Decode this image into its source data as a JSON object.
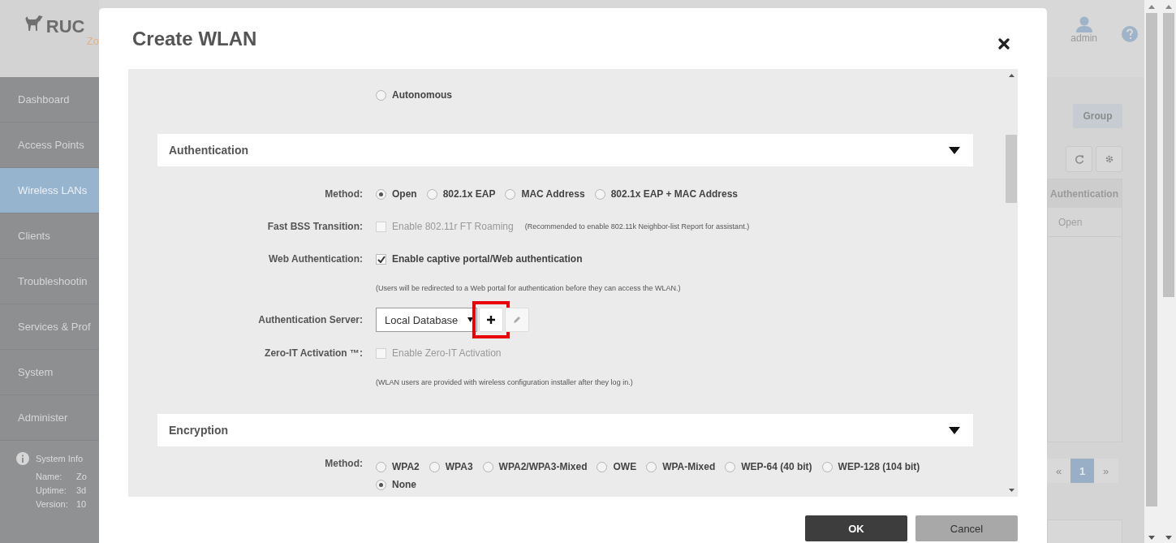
{
  "app": {
    "logo_text": "RUC",
    "logo_subtext": "Zo",
    "nav": [
      {
        "label": "Dashboard",
        "selected": false
      },
      {
        "label": "Access Points",
        "selected": false
      },
      {
        "label": "Wireless LANs",
        "selected": true
      },
      {
        "label": "Clients",
        "selected": false
      },
      {
        "label": "Troubleshootin",
        "selected": false
      },
      {
        "label": "Services & Prof",
        "selected": false
      },
      {
        "label": "System",
        "selected": false
      },
      {
        "label": "Administer",
        "selected": false
      }
    ],
    "system_info": {
      "title": "System Info",
      "rows": [
        {
          "label": "Name:",
          "value": "Zo"
        },
        {
          "label": "Uptime:",
          "value": "3d"
        },
        {
          "label": "Version:",
          "value": "10"
        }
      ]
    },
    "user": "admin",
    "view_tab": "Group",
    "table": {
      "columns": [
        "Authentication"
      ],
      "rows": [
        [
          "Open"
        ]
      ]
    },
    "pagination": [
      {
        "label": "«",
        "selected": false
      },
      {
        "label": "1",
        "selected": true
      },
      {
        "label": "»",
        "selected": false
      }
    ]
  },
  "dialog": {
    "title": "Create WLAN",
    "top_options": [
      {
        "label": "Autonomous",
        "selected": false
      }
    ],
    "sections": [
      {
        "title": "Authentication",
        "expanded": true,
        "rows": [
          {
            "kind": "radio",
            "label": "Method:",
            "options": [
              {
                "label": "Open",
                "selected": true
              },
              {
                "label": "802.1x EAP",
                "selected": false
              },
              {
                "label": "MAC Address",
                "selected": false
              },
              {
                "label": "802.1x EAP + MAC Address",
                "selected": false
              }
            ]
          },
          {
            "kind": "checkbox",
            "label": "Fast BSS Transition:",
            "text": "Enable 802.11r FT Roaming",
            "checked": false,
            "disabled": true,
            "note": "(Recommended to enable 802.11k Neighbor-list Report for assistant.)"
          },
          {
            "kind": "checkbox",
            "label": "Web Authentication:",
            "text": "Enable captive portal/Web authentication",
            "checked": true,
            "disabled": false
          },
          {
            "kind": "note",
            "text": "(Users will be redirected to a Web portal for authentication before they can access the WLAN.)"
          },
          {
            "kind": "select",
            "label": "Authentication Server:",
            "value": "Local Database",
            "add_highlighted": true
          },
          {
            "kind": "checkbox",
            "label": "Zero-IT Activation ™:",
            "text": "Enable Zero-IT Activation",
            "checked": false,
            "disabled": true
          },
          {
            "kind": "note",
            "text": "(WLAN users are provided with wireless configuration installer after they log in.)"
          }
        ]
      },
      {
        "title": "Encryption",
        "expanded": true,
        "rows": [
          {
            "kind": "radio",
            "label": "Method:",
            "options": [
              {
                "label": "WPA2",
                "selected": false
              },
              {
                "label": "WPA3",
                "selected": false
              },
              {
                "label": "WPA2/WPA3-Mixed",
                "selected": false
              },
              {
                "label": "OWE",
                "selected": false
              },
              {
                "label": "WPA-Mixed",
                "selected": false
              },
              {
                "label": "WEP-64 (40 bit)",
                "selected": false
              },
              {
                "label": "WEP-128 (104 bit)",
                "selected": false
              },
              {
                "label": "None",
                "selected": true
              }
            ]
          }
        ]
      }
    ],
    "buttons": [
      {
        "label": "OK",
        "kind": "primary"
      },
      {
        "label": "Cancel",
        "kind": "secondary"
      }
    ]
  }
}
